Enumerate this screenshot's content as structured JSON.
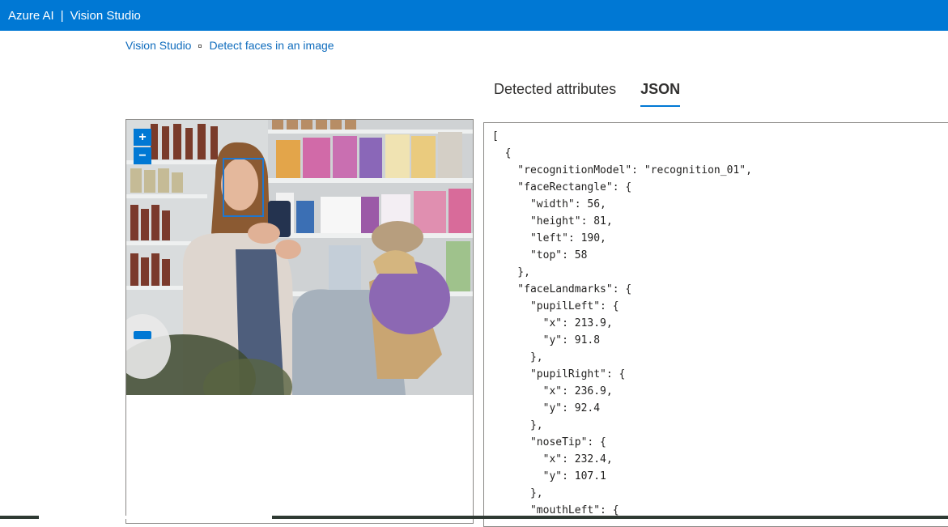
{
  "header": {
    "brand": "Azure AI",
    "separator": "|",
    "product": "Vision Studio"
  },
  "breadcrumb": {
    "home": "Vision Studio",
    "current": "Detect faces in an image"
  },
  "tabs": [
    {
      "label": "Detected attributes",
      "active": false
    },
    {
      "label": "JSON",
      "active": true
    }
  ],
  "zoom": {
    "in_label": "+",
    "out_label": "−"
  },
  "json_output": "[\n  {\n    \"recognitionModel\": \"recognition_01\",\n    \"faceRectangle\": {\n      \"width\": 56,\n      \"height\": 81,\n      \"left\": 190,\n      \"top\": 58\n    },\n    \"faceLandmarks\": {\n      \"pupilLeft\": {\n        \"x\": 213.9,\n        \"y\": 91.8\n      },\n      \"pupilRight\": {\n        \"x\": 236.9,\n        \"y\": 92.4\n      },\n      \"noseTip\": {\n        \"x\": 232.4,\n        \"y\": 107.1\n      },\n      \"mouthLeft\": {",
  "colors": {
    "accent": "#0078d4",
    "face_box": "#1e77d0"
  }
}
